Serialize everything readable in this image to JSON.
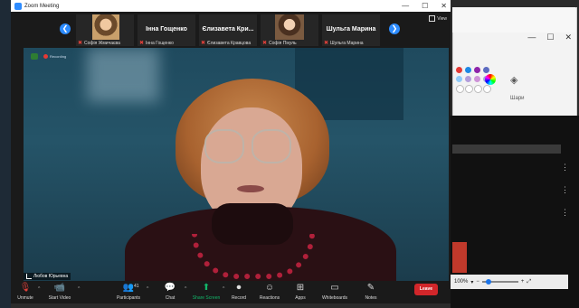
{
  "window": {
    "title": "Zoom Meeting"
  },
  "view_label": "View",
  "gallery": {
    "tiles": [
      {
        "name": "Софія Жмичаєва",
        "kind": "photo"
      },
      {
        "name": "Інна Гощенко",
        "display": "Інна Гощенко"
      },
      {
        "name": "Єлизавета Кравцова",
        "display": "Єлизавета Кри..."
      },
      {
        "name": "Софія Пікуль",
        "kind": "photo"
      },
      {
        "name": "Шульга Марина",
        "display": "Шульга Марина"
      }
    ]
  },
  "main_speaker": {
    "name": "Любов Юрьевна",
    "recording_text": "Recording"
  },
  "toolbar": {
    "unmute": "Unmute",
    "start_video": "Start Video",
    "participants": "Participants",
    "participants_count": "41",
    "chat": "Chat",
    "share_screen": "Share Screen",
    "record": "Record",
    "reactions": "Reactions",
    "apps": "Apps",
    "whiteboards": "Whiteboards",
    "notes": "Notes",
    "leave": "Leave"
  },
  "paint": {
    "layers_label": "Шари",
    "zoom_level": "100%",
    "swatch_colors": [
      "#e53935",
      "#1e88e5",
      "#8e24aa",
      "#5c6bc0",
      "#90caf9",
      "#b39ddb",
      "#ce93d8",
      "#9fa8da",
      "#ffffff",
      "#ffffff",
      "#ffffff",
      "#ffffff"
    ]
  },
  "colors": {
    "accent": "#2d8cff",
    "leave": "#d1262a",
    "share": "#12b76a",
    "muted": "#e0403a"
  }
}
